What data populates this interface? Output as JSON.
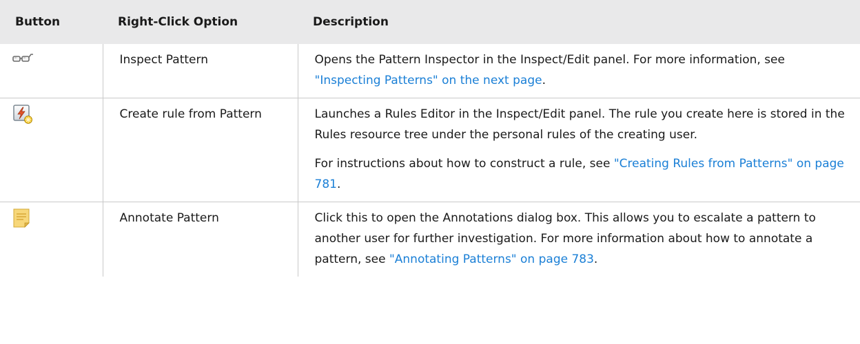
{
  "table": {
    "headers": {
      "button": "Button",
      "option": "Right-Click Option",
      "description": "Description"
    },
    "rows": [
      {
        "icon": "inspect-glasses-icon",
        "option": "Inspect Pattern",
        "desc1_text": "Opens the Pattern Inspector in the Inspect/Edit panel. For more information, see ",
        "desc1_link": "\"Inspecting Patterns\" on the next page",
        "desc1_end": "."
      },
      {
        "icon": "create-rule-icon",
        "option": "Create rule from Pattern",
        "desc1_text": "Launches a Rules Editor in the Inspect/Edit panel. The rule you create here is stored in the Rules resource tree under the personal rules of the creating user.",
        "desc2_text": "For instructions about how to construct a rule, see ",
        "desc2_link": "\"Creating Rules from Patterns\" on page 781",
        "desc2_end": "."
      },
      {
        "icon": "annotate-note-icon",
        "option": "Annotate Pattern",
        "desc1_text": "Click this to open the Annotations dialog box. This allows you to escalate a pattern to another user for further investigation. For more information about how to annotate a pattern, see ",
        "desc1_link": "\"Annotating Patterns\" on page 783",
        "desc1_end": "."
      }
    ]
  },
  "colors": {
    "header_bg": "#e9e9ea",
    "link": "#1a7fd6",
    "rule": "#c9c9c9"
  }
}
